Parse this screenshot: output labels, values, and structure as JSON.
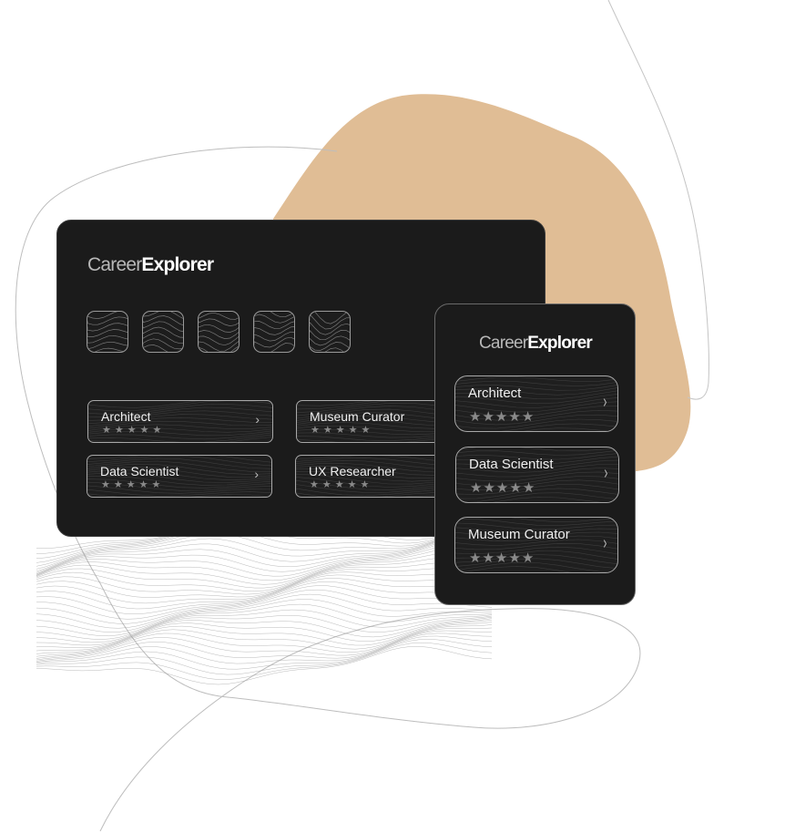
{
  "colors": {
    "accent_blob": "#e0bd95",
    "card_bg": "#1b1b1b",
    "star": "#8a8a8a"
  },
  "desktop": {
    "logo": {
      "part1": "Career",
      "part2": "Explorer"
    },
    "thumbnails": [
      {
        "label": "pattern-1"
      },
      {
        "label": "pattern-2"
      },
      {
        "label": "pattern-3"
      },
      {
        "label": "pattern-4"
      },
      {
        "label": "pattern-5"
      }
    ],
    "jobs": [
      {
        "title": "Architect",
        "rating": 5,
        "max_rating": 5
      },
      {
        "title": "Museum Curator",
        "rating": 5,
        "max_rating": 5
      },
      {
        "title": "Data Scientist",
        "rating": 5,
        "max_rating": 5
      },
      {
        "title": "UX Researcher",
        "rating": 5,
        "max_rating": 5
      }
    ]
  },
  "mobile": {
    "logo": {
      "part1": "Career",
      "part2": "Explorer"
    },
    "jobs": [
      {
        "title": "Architect",
        "rating": 5,
        "max_rating": 5
      },
      {
        "title": "Data Scientist",
        "rating": 5,
        "max_rating": 5
      },
      {
        "title": "Museum Curator",
        "rating": 5,
        "max_rating": 5
      }
    ]
  },
  "icons": {
    "star": "★",
    "chevron": "›"
  }
}
